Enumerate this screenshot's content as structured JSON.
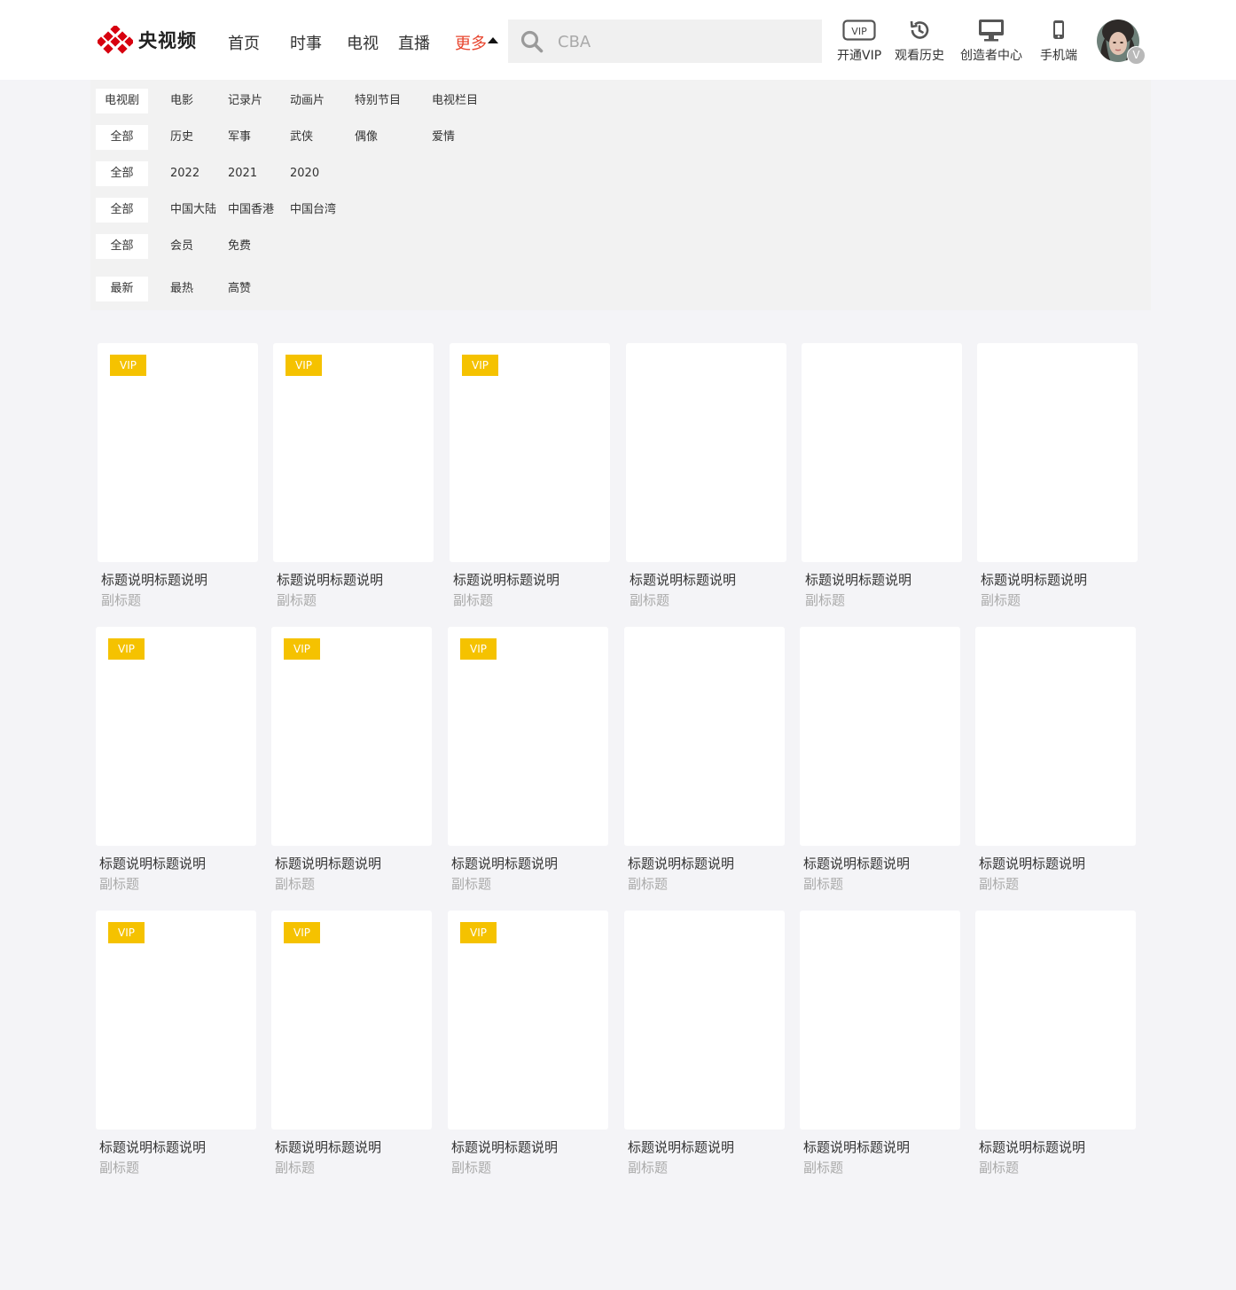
{
  "brand": {
    "name": "央视频",
    "accent": "#e8452e",
    "logo_red": "#d7000f"
  },
  "nav": [
    {
      "label": "首页"
    },
    {
      "label": "时事"
    },
    {
      "label": "电视"
    },
    {
      "label": "直播"
    },
    {
      "label": "更多"
    }
  ],
  "search": {
    "placeholder": "CBA",
    "icon": "search-icon"
  },
  "tools": [
    {
      "label": "开通VIP",
      "icon": "vip-icon",
      "icon_text": "VIP"
    },
    {
      "label": "观看历史",
      "icon": "history-icon"
    },
    {
      "label": "创造者中心",
      "icon": "monitor-icon"
    },
    {
      "label": "手机端",
      "icon": "phone-icon"
    }
  ],
  "avatar": {
    "badge": "V"
  },
  "filters": {
    "category": [
      "电视剧",
      "电影",
      "记录片",
      "动画片",
      "特别节目",
      "电视栏目"
    ],
    "genre": [
      "全部",
      "历史",
      "军事",
      "武侠",
      "偶像",
      "爱情"
    ],
    "year": [
      "全部",
      "2022",
      "2021",
      "2020"
    ],
    "region": [
      "全部",
      "中国大陆",
      "中国香港",
      "中国台湾"
    ],
    "pay": [
      "全部",
      "会员",
      "免费"
    ],
    "sort": [
      "最新",
      "最热",
      "高赞"
    ]
  },
  "vip_color": "#f5c200",
  "cards": [
    {
      "title": "标题说明标题说明",
      "subtitle": "副标题",
      "vip": "VIP"
    },
    {
      "title": "标题说明标题说明",
      "subtitle": "副标题",
      "vip": "VIP"
    },
    {
      "title": "标题说明标题说明",
      "subtitle": "副标题",
      "vip": "VIP"
    },
    {
      "title": "标题说明标题说明",
      "subtitle": "副标题",
      "vip": ""
    },
    {
      "title": "标题说明标题说明",
      "subtitle": "副标题",
      "vip": ""
    },
    {
      "title": "标题说明标题说明",
      "subtitle": "副标题",
      "vip": ""
    },
    {
      "title": "标题说明标题说明",
      "subtitle": "副标题",
      "vip": "VIP"
    },
    {
      "title": "标题说明标题说明",
      "subtitle": "副标题",
      "vip": "VIP"
    },
    {
      "title": "标题说明标题说明",
      "subtitle": "副标题",
      "vip": "VIP"
    },
    {
      "title": "标题说明标题说明",
      "subtitle": "副标题",
      "vip": ""
    },
    {
      "title": "标题说明标题说明",
      "subtitle": "副标题",
      "vip": ""
    },
    {
      "title": "标题说明标题说明",
      "subtitle": "副标题",
      "vip": ""
    },
    {
      "title": "标题说明标题说明",
      "subtitle": "副标题",
      "vip": "VIP"
    },
    {
      "title": "标题说明标题说明",
      "subtitle": "副标题",
      "vip": "VIP"
    },
    {
      "title": "标题说明标题说明",
      "subtitle": "副标题",
      "vip": "VIP"
    },
    {
      "title": "标题说明标题说明",
      "subtitle": "副标题",
      "vip": ""
    },
    {
      "title": "标题说明标题说明",
      "subtitle": "副标题",
      "vip": ""
    },
    {
      "title": "标题说明标题说明",
      "subtitle": "副标题",
      "vip": ""
    }
  ]
}
